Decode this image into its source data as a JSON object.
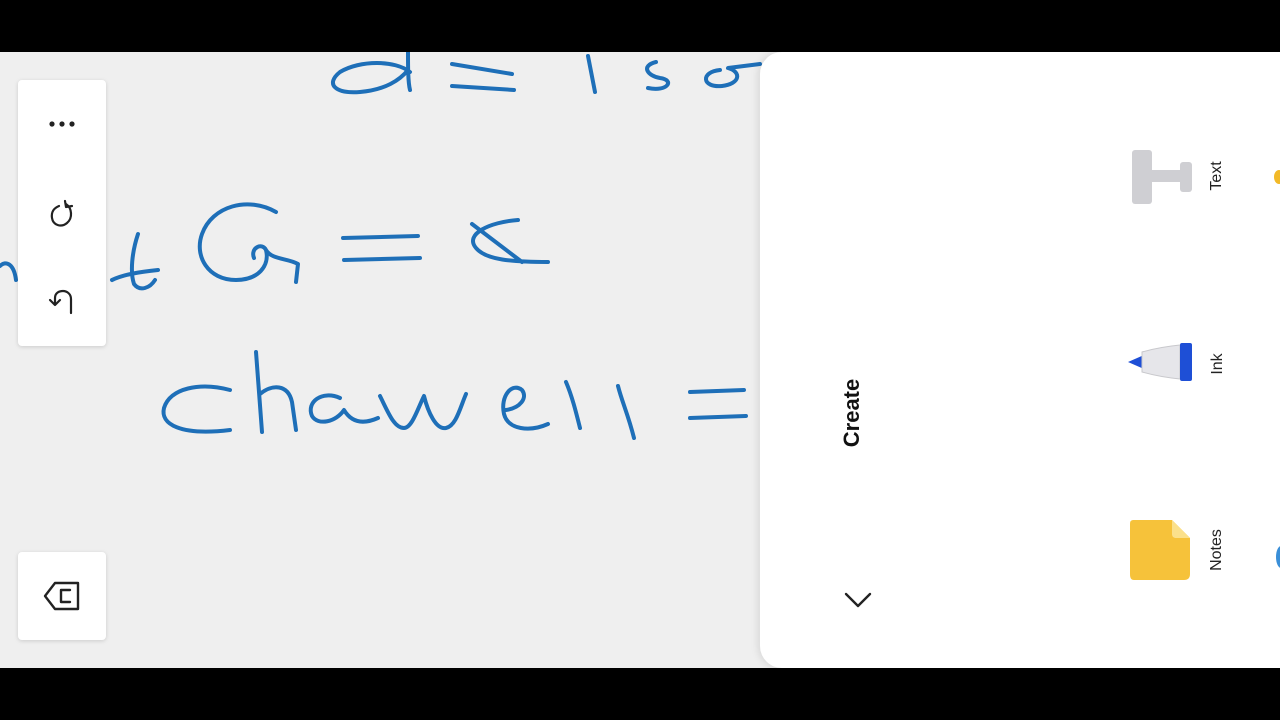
{
  "toolbar": {
    "more_icon": "more-horizontal-icon",
    "redo_icon": "redo-icon",
    "undo_icon": "undo-icon"
  },
  "exit_button": {
    "icon": "exit-arrow-icon"
  },
  "create_panel": {
    "title": "Create",
    "collapse_icon": "chevron-down-icon",
    "items": [
      {
        "label": "Text",
        "icon": "text-tool-icon"
      },
      {
        "label": "Ink",
        "icon": "ink-pen-icon"
      },
      {
        "label": "Notes",
        "icon": "sticky-note-icon"
      }
    ]
  },
  "colors": {
    "ink": "#1e6fb8",
    "canvas": "#efefef",
    "panel": "#ffffff",
    "letterbox": "#000000"
  }
}
